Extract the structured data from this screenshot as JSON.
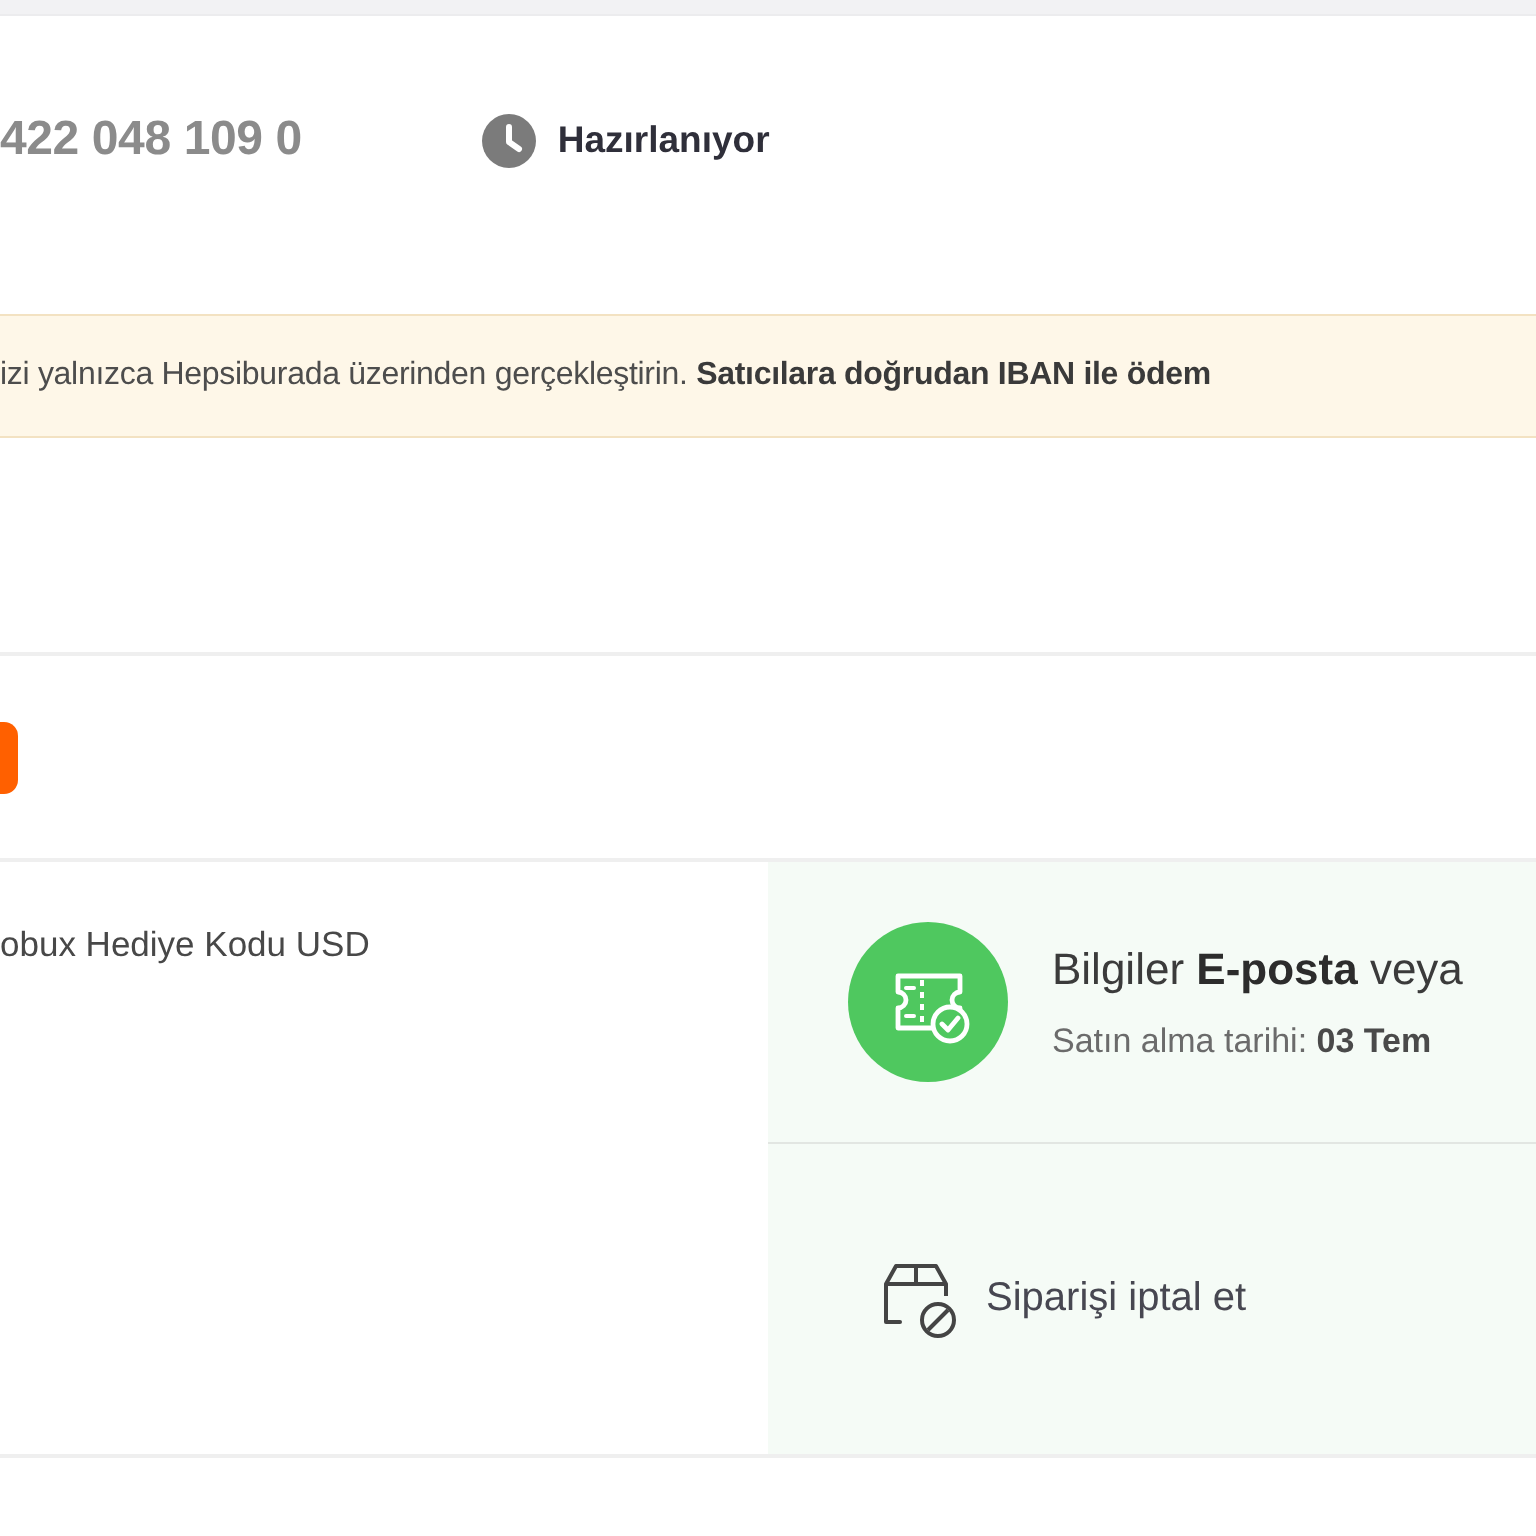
{
  "order": {
    "number": "422 048 109 0",
    "status": "Hazırlanıyor"
  },
  "notice": {
    "text": "izi yalnızca Hepsiburada üzerinden gerçekleştirin. **Satıcılara doğrudan IBAN ile ödem**"
  },
  "product": {
    "name": "obux Hediye Kodu USD"
  },
  "delivery": {
    "message": "Bilgiler **E-posta** veya",
    "purchase_date": "Satın alma tarihi: **03 Tem**"
  },
  "actions": [
    {
      "kind": "cancel",
      "label": "Siparişi iptal et"
    }
  ]
}
